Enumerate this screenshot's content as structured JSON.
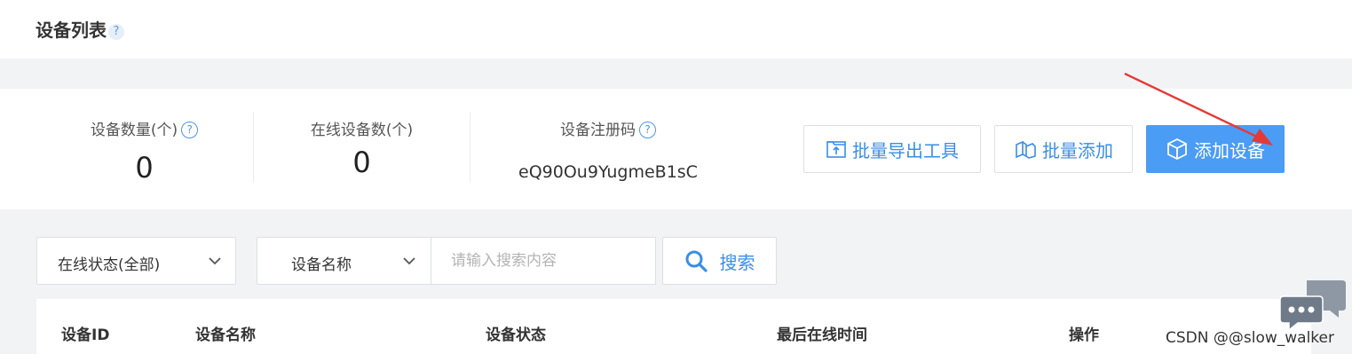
{
  "page": {
    "title": "设备列表",
    "title_help": "?"
  },
  "stats": {
    "device_count_label": "设备数量(个)",
    "device_count_value": "0",
    "online_count_label": "在线设备数(个)",
    "online_count_value": "0",
    "reg_code_label": "设备注册码",
    "reg_code_value": "eQ90Ou9YugmeB1sC",
    "help_glyph": "?"
  },
  "actions": {
    "bulk_export_label": "批量导出工具",
    "bulk_add_label": "批量添加",
    "add_device_label": "添加设备"
  },
  "filters": {
    "status_select": "在线状态(全部)",
    "field_select": "设备名称",
    "search_placeholder": "请输入搜索内容",
    "search_label": "搜索"
  },
  "table": {
    "columns": [
      "设备ID",
      "设备名称",
      "设备状态",
      "最后在线时间",
      "操作"
    ]
  },
  "watermark": "CSDN @@slow_walker",
  "colors": {
    "accent": "#4b9cf5",
    "link": "#3a8ee6",
    "arrow": "#e53935"
  }
}
